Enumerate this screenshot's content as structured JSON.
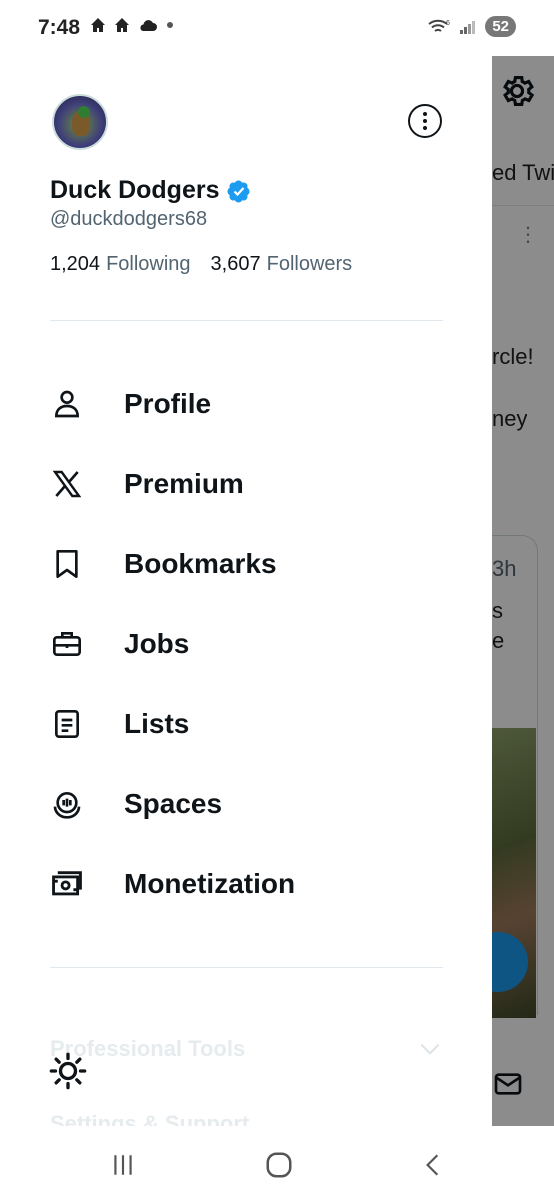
{
  "status_bar": {
    "time": "7:48",
    "battery": "52",
    "signal_label": "6"
  },
  "background": {
    "tab_partial": "ed Twi",
    "tweet_text_1": "rcle!",
    "tweet_text_2": "ney",
    "timestamp_partial": "3h",
    "card_text_1": "s",
    "card_text_2": "e"
  },
  "profile": {
    "display_name": "Duck Dodgers",
    "handle": "@duckdodgers68",
    "following_count": "1,204",
    "following_label": "Following",
    "followers_count": "3,607",
    "followers_label": "Followers"
  },
  "menu": {
    "items": [
      {
        "label": "Profile",
        "icon": "person-icon"
      },
      {
        "label": "Premium",
        "icon": "x-logo-icon"
      },
      {
        "label": "Bookmarks",
        "icon": "bookmark-icon"
      },
      {
        "label": "Jobs",
        "icon": "briefcase-icon"
      },
      {
        "label": "Lists",
        "icon": "list-icon"
      },
      {
        "label": "Spaces",
        "icon": "spaces-icon"
      },
      {
        "label": "Monetization",
        "icon": "money-icon"
      }
    ]
  },
  "sections": {
    "professional_tools": "Professional Tools",
    "settings_support": "Settings & Support"
  },
  "colors": {
    "verified": "#1d9bf0",
    "text_primary": "#0f1419",
    "text_secondary": "#536471"
  }
}
